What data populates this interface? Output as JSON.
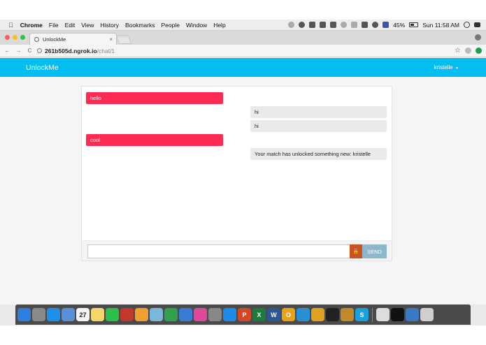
{
  "os_menubar": {
    "apple": "",
    "app_name": "Chrome",
    "menus": [
      "File",
      "Edit",
      "View",
      "History",
      "Bookmarks",
      "People",
      "Window",
      "Help"
    ],
    "battery": "45%",
    "clock": "Sun 11:58 AM"
  },
  "browser": {
    "tab_title": "UnlockMe",
    "tab_close": "×",
    "back": "←",
    "forward": "→",
    "reload": "C",
    "url_host": "261b505d.ngrok.io",
    "url_path": "/chat/1",
    "bookmark_star": "☆"
  },
  "app": {
    "brand": "UnlockMe",
    "user": "kristelle",
    "user_caret": "▾"
  },
  "chat": {
    "messages": [
      {
        "side": "sent",
        "text": "hello"
      },
      {
        "side": "received",
        "text": "hi"
      },
      {
        "side": "received",
        "text": "hi"
      },
      {
        "side": "sent",
        "text": "cool"
      },
      {
        "side": "received",
        "text": "Your match has unlocked something new: kristelle"
      }
    ],
    "input_value": "",
    "unlock_icon": "🔓",
    "send_label": "SEND"
  },
  "colors": {
    "navbar": "#04bdf1",
    "sent_bubble": "#fc2b53",
    "received_bubble": "#eaeaea",
    "unlock_button": "#c9531f",
    "send_button": "#8db7cc"
  },
  "dock": {
    "icons": [
      {
        "name": "finder-icon",
        "glyph": "",
        "color": "#2f7fe0"
      },
      {
        "name": "launchpad-icon",
        "glyph": "",
        "color": "#8a8a8a"
      },
      {
        "name": "safari-icon",
        "glyph": "",
        "color": "#1e90e8"
      },
      {
        "name": "mail-icon",
        "glyph": "",
        "color": "#5b8fd6"
      },
      {
        "name": "calendar-icon",
        "glyph": "27",
        "color": "#f4f4f4"
      },
      {
        "name": "notes-icon",
        "glyph": "",
        "color": "#f5d66b"
      },
      {
        "name": "facetime-icon",
        "glyph": "",
        "color": "#2cbf4a"
      },
      {
        "name": "photo-booth-icon",
        "glyph": "",
        "color": "#c0392b"
      },
      {
        "name": "photos-icon",
        "glyph": "",
        "color": "#f0a030"
      },
      {
        "name": "preview-icon",
        "glyph": "",
        "color": "#7ab7d9"
      },
      {
        "name": "numbers-icon",
        "glyph": "",
        "color": "#31a24c"
      },
      {
        "name": "keynote-icon",
        "glyph": "",
        "color": "#3a7bd5"
      },
      {
        "name": "itunes-icon",
        "glyph": "",
        "color": "#e0499a"
      },
      {
        "name": "system-preferences-icon",
        "glyph": "",
        "color": "#888888"
      },
      {
        "name": "app-store-icon",
        "glyph": "",
        "color": "#1d8ce8"
      },
      {
        "name": "powerpoint-icon",
        "glyph": "P",
        "color": "#d24726"
      },
      {
        "name": "excel-icon",
        "glyph": "X",
        "color": "#1f7a3e"
      },
      {
        "name": "word-icon",
        "glyph": "W",
        "color": "#2b5797"
      },
      {
        "name": "outlook-icon",
        "glyph": "O",
        "color": "#e8a317"
      },
      {
        "name": "ie-icon",
        "glyph": "",
        "color": "#2b8fd6"
      },
      {
        "name": "chrome-icon",
        "glyph": "",
        "color": "#e0a020"
      },
      {
        "name": "terminal-icon",
        "glyph": "",
        "color": "#222222"
      },
      {
        "name": "tool-icon",
        "glyph": "",
        "color": "#c08a2a"
      },
      {
        "name": "skype-icon",
        "glyph": "S",
        "color": "#1aa0e0"
      },
      {
        "name": "window-thumb-icon",
        "glyph": "",
        "color": "#dddddd"
      },
      {
        "name": "window-thumb-icon",
        "glyph": "",
        "color": "#111111"
      },
      {
        "name": "downloads-icon",
        "glyph": "",
        "color": "#3b78c4"
      },
      {
        "name": "trash-icon",
        "glyph": "",
        "color": "#cfcfcf"
      }
    ]
  }
}
